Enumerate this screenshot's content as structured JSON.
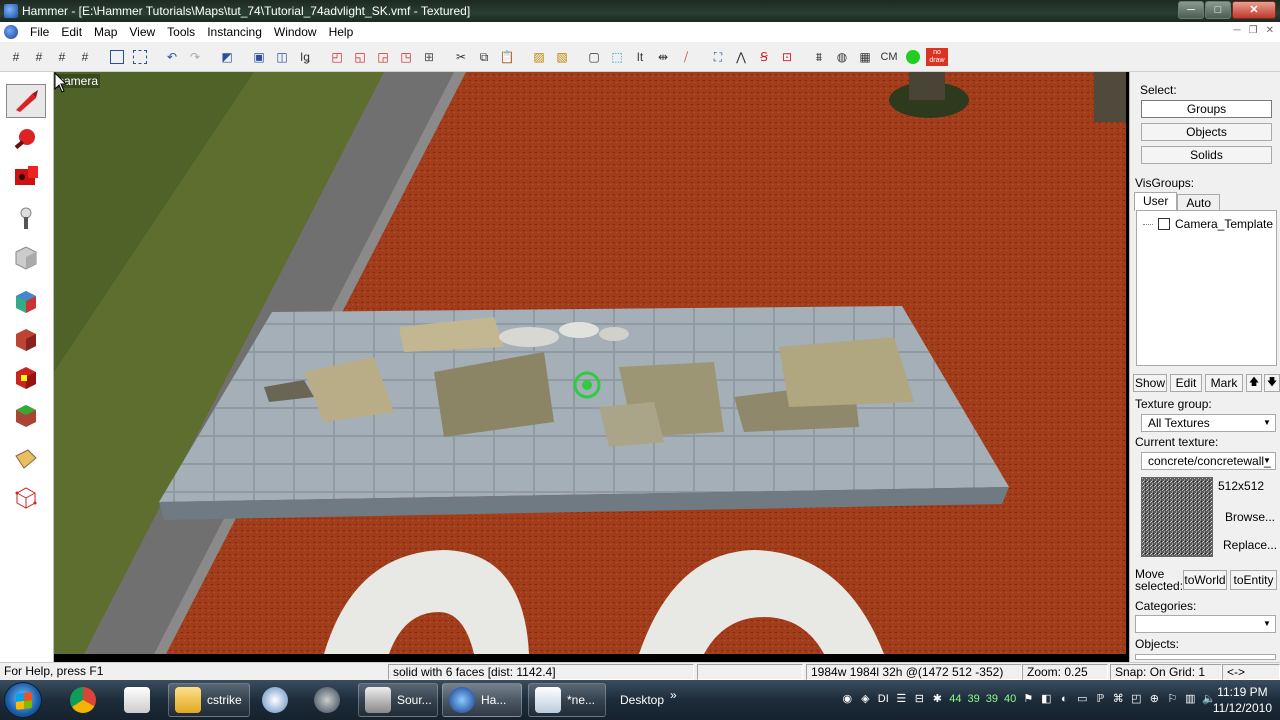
{
  "window": {
    "title": "Hammer - [E:\\Hammer Tutorials\\Maps\\tut_74\\Tutorial_74advlight_SK.vmf - Textured]",
    "minimize": "─",
    "maximize": "□",
    "close": "✕"
  },
  "menu": {
    "items": [
      "File",
      "Edit",
      "Map",
      "View",
      "Tools",
      "Instancing",
      "Window",
      "Help"
    ],
    "mdi": [
      "─",
      "❐",
      "✕"
    ]
  },
  "toolbar": {
    "cm_label": "CM",
    "nodraw_label": "no draw"
  },
  "viewport": {
    "label": "camera"
  },
  "right_panel": {
    "select_label": "Select:",
    "groups_button": "Groups",
    "objects_button": "Objects",
    "solids_button": "Solids",
    "visgroups_label": "VisGroups:",
    "tab_user": "User",
    "tab_auto": "Auto",
    "visgroup_item": "Camera_Template",
    "show_button": "Show",
    "edit_button": "Edit",
    "mark_button": "Mark",
    "up_button": "🡅",
    "down_button": "🡇",
    "texture_group_label": "Texture group:",
    "texture_group_value": "All Textures",
    "current_texture_label": "Current texture:",
    "current_texture_value": "concrete/concretewall_",
    "texture_size": "512x512",
    "browse_button": "Browse...",
    "replace_button": "Replace...",
    "move_selected_label_1": "Move",
    "move_selected_label_2": "selected:",
    "to_world_button": "toWorld",
    "to_entity_button": "toEntity",
    "categories_label": "Categories:",
    "objects_label": "Objects:"
  },
  "statusbar": {
    "help": "For Help, press F1",
    "selection": "solid with 6 faces  [dist: 1142.4]",
    "size": "1984w 1984l 32h @(1472 512 -352)",
    "zoom": "Zoom: 0.25",
    "snap": "Snap: On Grid: 1",
    "extra": "<->"
  },
  "taskbar": {
    "cstrike": "cstrike",
    "source": "Sour...",
    "hammer": "Ha...",
    "notepad": "*ne...",
    "desktop": "Desktop",
    "desktop_chevron": "»",
    "tray_numbers": [
      "44",
      "39",
      "39",
      "40"
    ],
    "tray_di": "DI",
    "time": "11:19 PM",
    "date": "11/12/2010"
  }
}
